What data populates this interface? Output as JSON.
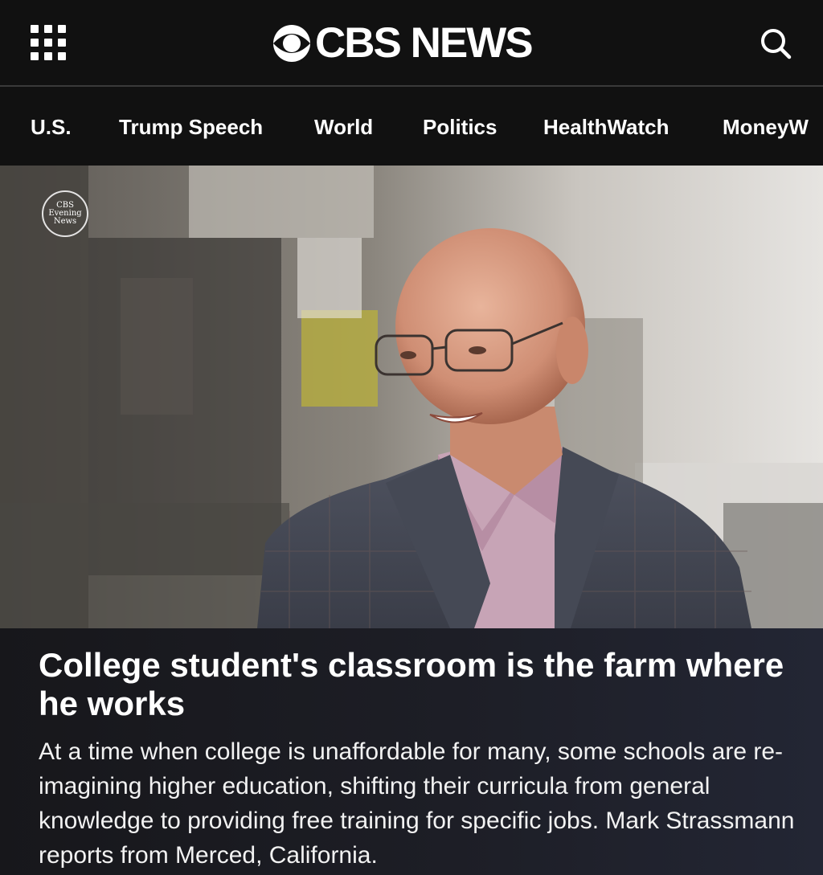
{
  "header": {
    "logo_text": "CBS NEWS",
    "menu_icon": "grid-menu-icon",
    "search_icon": "search-icon"
  },
  "nav": {
    "items": [
      {
        "label": "U.S."
      },
      {
        "label": "Trump Speech"
      },
      {
        "label": "World"
      },
      {
        "label": "Politics"
      },
      {
        "label": "HealthWatch"
      },
      {
        "label": "MoneyW"
      }
    ]
  },
  "hero": {
    "badge_lines": [
      "CBS",
      "Evening",
      "News"
    ]
  },
  "story": {
    "headline": "College student's classroom is the farm where he works",
    "dek": "At a time when college is unaffordable for many, some schools are re-imagining higher education, shifting their curricula from general knowledge to providing free training for specific jobs. Mark Strassmann reports from Merced, California."
  },
  "colors": {
    "background": "#111111",
    "text": "#ffffff",
    "story_panel": "#1d1e26"
  }
}
